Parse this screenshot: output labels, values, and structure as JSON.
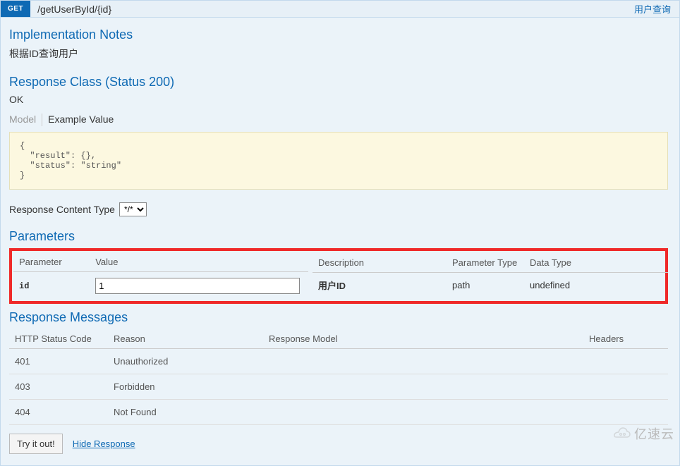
{
  "http_method": "GET",
  "path": "/getUserById/{id}",
  "summary": "用户查询",
  "sections": {
    "impl_notes_title": "Implementation Notes",
    "impl_notes_text": "根据ID查询用户",
    "response_class_title": "Response Class (Status 200)",
    "response_class_text": "OK",
    "parameters_title": "Parameters",
    "response_messages_title": "Response Messages"
  },
  "tabs": {
    "model": "Model",
    "example": "Example Value"
  },
  "example_json": "{\n  \"result\": {},\n  \"status\": \"string\"\n}",
  "content_type": {
    "label": "Response Content Type",
    "selected": "*/*",
    "options": [
      "*/*"
    ]
  },
  "param_headers": {
    "parameter": "Parameter",
    "value": "Value",
    "description": "Description",
    "ptype": "Parameter Type",
    "dtype": "Data Type"
  },
  "parameters": [
    {
      "name": "id",
      "value": "1",
      "description": "用户ID",
      "ptype": "path",
      "dtype": "undefined"
    }
  ],
  "response_headers": {
    "code": "HTTP Status Code",
    "reason": "Reason",
    "model": "Response Model",
    "headers": "Headers"
  },
  "responses": [
    {
      "code": "401",
      "reason": "Unauthorized",
      "model": "",
      "headers": ""
    },
    {
      "code": "403",
      "reason": "Forbidden",
      "model": "",
      "headers": ""
    },
    {
      "code": "404",
      "reason": "Not Found",
      "model": "",
      "headers": ""
    }
  ],
  "actions": {
    "try": "Try it out!",
    "hide": "Hide Response"
  },
  "watermark": "亿速云"
}
